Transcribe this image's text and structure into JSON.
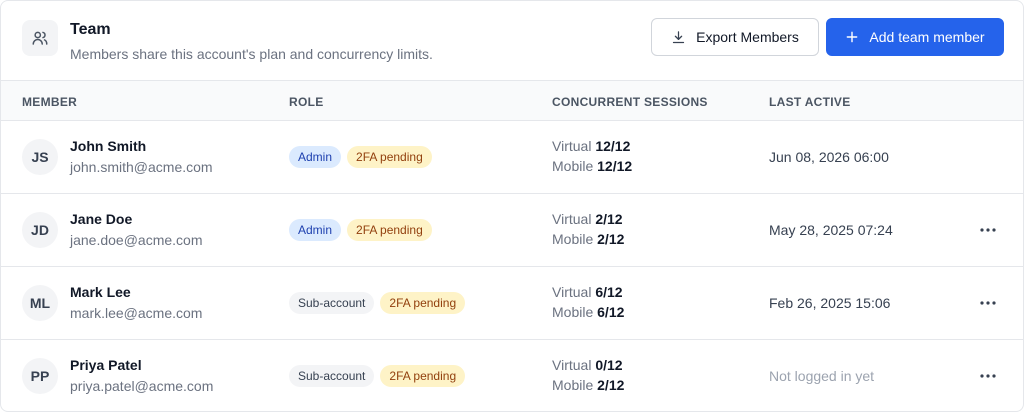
{
  "header": {
    "title": "Team",
    "subtitle": "Members share this account's plan and concurrency limits.",
    "export_label": "Export Members",
    "add_label": "Add team member"
  },
  "colors": {
    "primary": "#2563eb",
    "admin_badge": "#dbeafe",
    "twofa_badge": "#fef3c7",
    "sub_badge": "#f3f4f6"
  },
  "table": {
    "columns": [
      "MEMBER",
      "ROLE",
      "CONCURRENT SESSIONS",
      "LAST ACTIVE"
    ],
    "virtual_label": "Virtual",
    "mobile_label": "Mobile",
    "rows": [
      {
        "initials": "JS",
        "name": "John Smith",
        "email": "john.smith@acme.com",
        "role": "Admin",
        "status": "2FA pending",
        "virtual": "12/12",
        "mobile": "12/12",
        "last_active": "Jun 08, 2026 06:00"
      },
      {
        "initials": "JD",
        "name": "Jane Doe",
        "email": "jane.doe@acme.com",
        "role": "Admin",
        "status": "2FA pending",
        "virtual": "2/12",
        "mobile": "2/12",
        "last_active": "May 28, 2025 07:24"
      },
      {
        "initials": "ML",
        "name": "Mark Lee",
        "email": "mark.lee@acme.com",
        "role": "Sub-account",
        "status": "2FA pending",
        "virtual": "6/12",
        "mobile": "6/12",
        "last_active": "Feb 26, 2025 15:06"
      },
      {
        "initials": "PP",
        "name": "Priya Patel",
        "email": "priya.patel@acme.com",
        "role": "Sub-account",
        "status": "2FA pending",
        "virtual": "0/12",
        "mobile": "2/12",
        "last_active": "Not logged in yet"
      }
    ]
  }
}
